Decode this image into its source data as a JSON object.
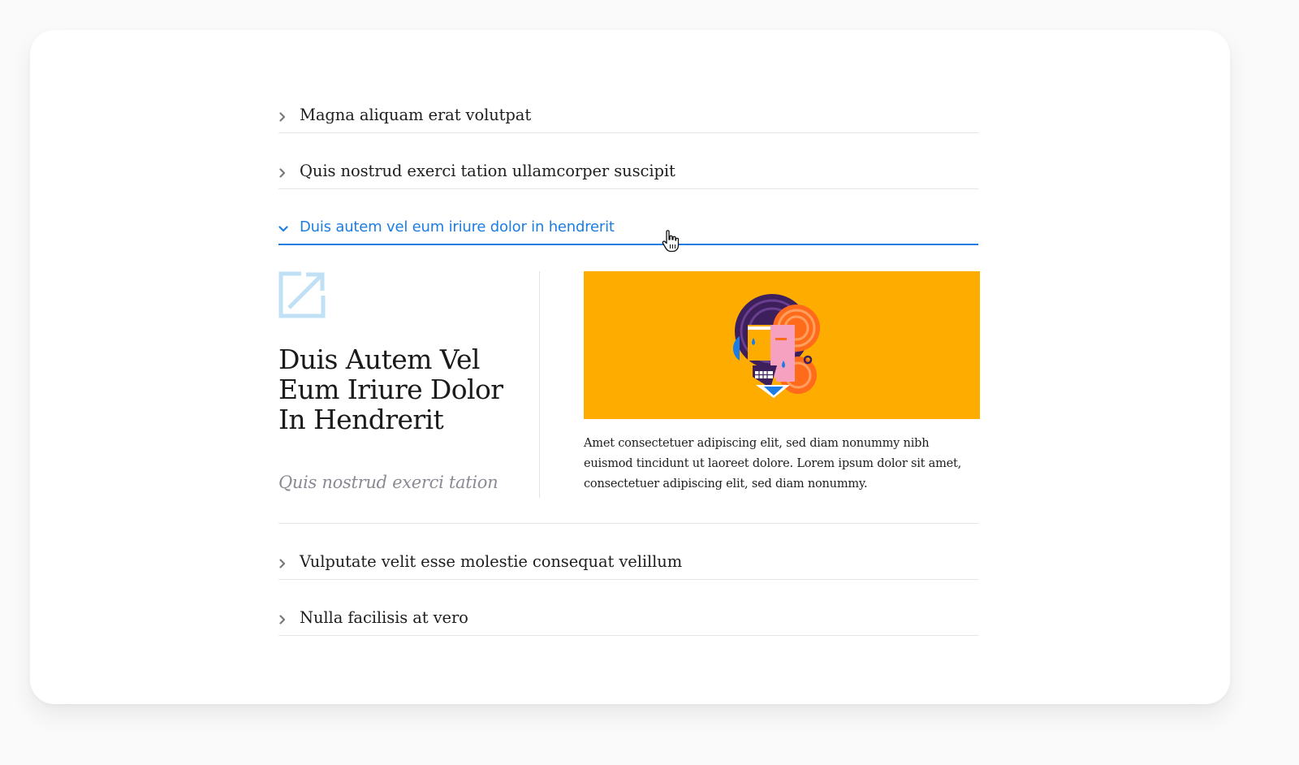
{
  "accordion": {
    "items": [
      {
        "label": "Magna aliquam erat volutpat"
      },
      {
        "label": "Quis nostrud exerci tation ullamcorper suscipit"
      },
      {
        "label": "Duis autem vel eum iriure dolor in hendrerit"
      },
      {
        "label": "Vulputate velit esse molestie consequat velillum"
      },
      {
        "label": "Nulla facilisis at vero"
      }
    ],
    "expanded": {
      "title": "Duis Autem Vel Eum Iriure Dolor In Hendrerit",
      "subtitle": "Quis nostrud exerci tation",
      "body": "Amet consectetuer adipiscing elit, sed diam nonummy nibh euismod tincidunt ut laoreet dolore. Lorem ipsum dolor sit amet, consectetuer adipiscing elit, sed diam nonummy.",
      "icon": "external-link-icon"
    }
  },
  "colors": {
    "accent": "#1d7de3",
    "hero_bg": "#ffac00",
    "icon_tint": "#bfe0f5"
  }
}
